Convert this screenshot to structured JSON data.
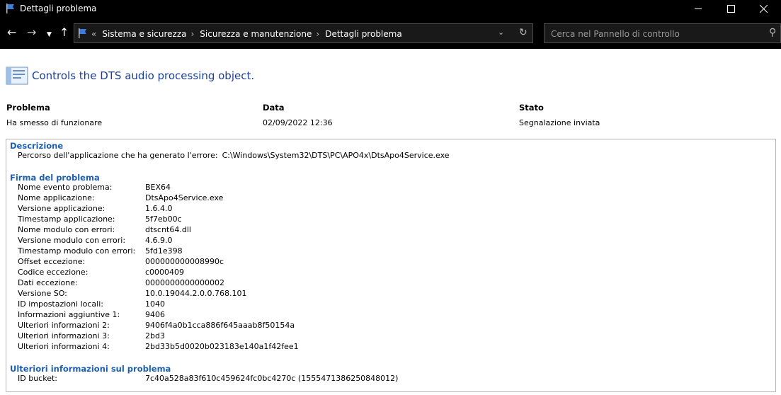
{
  "window": {
    "title": "Dettagli problema"
  },
  "address": {
    "overflow": "«",
    "breadcrumbs": [
      "Sistema e sicurezza",
      "Sicurezza e manutenzione",
      "Dettagli problema"
    ]
  },
  "search": {
    "placeholder": "Cerca nel Pannello di controllo"
  },
  "header": {
    "title": "Controls the DTS audio processing object."
  },
  "summary": {
    "problem_label": "Problema",
    "problem_value": "Ha smesso di funzionare",
    "date_label": "Data",
    "date_value": "02/09/2022 12:36",
    "status_label": "Stato",
    "status_value": "Segnalazione inviata"
  },
  "description": {
    "title": "Descrizione",
    "label": "Percorso dell'applicazione che ha generato l'errore:",
    "value": "C:\\Windows\\System32\\DTS\\PC\\APO4x\\DtsApo4Service.exe"
  },
  "signature": {
    "title": "Firma del problema",
    "rows": [
      {
        "k": "Nome evento problema:",
        "v": "BEX64"
      },
      {
        "k": "Nome applicazione:",
        "v": "DtsApo4Service.exe"
      },
      {
        "k": "Versione applicazione:",
        "v": "1.6.4.0"
      },
      {
        "k": "Timestamp applicazione:",
        "v": "5f7eb00c"
      },
      {
        "k": "Nome modulo con errori:",
        "v": "dtscnt64.dll"
      },
      {
        "k": "Versione modulo con errori:",
        "v": "4.6.9.0"
      },
      {
        "k": "Timestamp modulo con errori:",
        "v": "5fd1e398"
      },
      {
        "k": "Offset eccezione:",
        "v": "000000000008990c"
      },
      {
        "k": "Codice eccezione:",
        "v": "c0000409"
      },
      {
        "k": "Dati eccezione:",
        "v": "0000000000000002"
      },
      {
        "k": "Versione SO:",
        "v": "10.0.19044.2.0.0.768.101"
      },
      {
        "k": "ID impostazioni locali:",
        "v": "1040"
      },
      {
        "k": "Informazioni aggiuntive 1:",
        "v": "9406"
      },
      {
        "k": "Ulteriori informazioni 2:",
        "v": "9406f4a0b1cca886f645aaab8f50154a"
      },
      {
        "k": "Ulteriori informazioni 3:",
        "v": "2bd3"
      },
      {
        "k": "Ulteriori informazioni 4:",
        "v": "2bd33b5d0020b023183e140a1f42fee1"
      }
    ]
  },
  "extra": {
    "title": "Ulteriori informazioni sul problema",
    "rows": [
      {
        "k": "ID bucket:",
        "v": "7c40a528a83f610c459624fc0bc4270c (1555471386250848012)"
      }
    ]
  }
}
